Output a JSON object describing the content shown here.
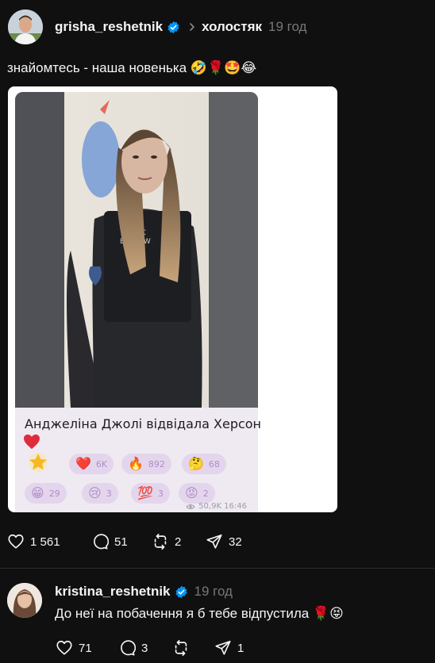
{
  "post": {
    "username": "grisha_reshetnik",
    "topic": "холостяк",
    "time": "19 год",
    "text": "знайомтесь - наша новенька 🤣🌹🤩😂",
    "media": {
      "caption": "Анджеліна Джолі відвідала Херсон",
      "reactions": [
        {
          "emoji": "❤️",
          "count": "6K"
        },
        {
          "emoji": "🔥",
          "count": "892"
        },
        {
          "emoji": "🤔",
          "count": "68"
        },
        {
          "emoji": "😁",
          "count": "29"
        },
        {
          "emoji": "😢",
          "count": "3"
        },
        {
          "emoji": "💯",
          "count": "3"
        },
        {
          "emoji": "😡",
          "count": "2"
        }
      ],
      "views": "50,9K 16:46"
    },
    "actions": {
      "likes": "1 561",
      "comments": "51",
      "reposts": "2",
      "shares": "32"
    }
  },
  "reply": {
    "username": "kristina_reshetnik",
    "time": "19 год",
    "text": "До неї на побачення я б тебе відпустила 🌹😝",
    "actions": {
      "likes": "71",
      "comments": "3",
      "shares": "1"
    }
  },
  "colors": {
    "background": "#101010",
    "verified": "#0095f6",
    "muted": "#777777"
  }
}
